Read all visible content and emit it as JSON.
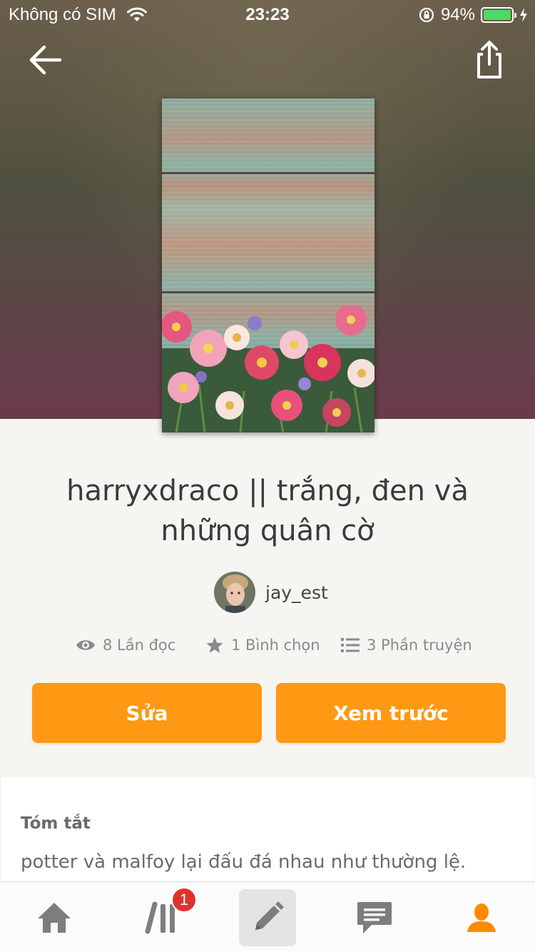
{
  "status_bar": {
    "carrier": "Không có SIM",
    "time": "23:23",
    "battery": "94%",
    "battery_level": 0.94
  },
  "header": {
    "back_icon": "arrow-left-icon",
    "share_icon": "share-icon"
  },
  "story": {
    "title": "harryxdraco || trắng, đen và những quân cờ",
    "author": "jay_est",
    "stats": {
      "reads": "8 Lần đọc",
      "votes": "1 Bình chọn",
      "parts": "3 Phần truyện"
    },
    "edit_label": "Sửa",
    "preview_label": "Xem trước",
    "summary_heading": "Tóm tắt",
    "summary_text": "potter và malfoy lại đấu đá nhau như thường lệ."
  },
  "tabbar": {
    "items": [
      {
        "icon": "home-icon"
      },
      {
        "icon": "library-icon",
        "badge": "1"
      },
      {
        "icon": "pencil-icon"
      },
      {
        "icon": "chat-icon"
      },
      {
        "icon": "profile-icon"
      }
    ]
  },
  "colors": {
    "accent": "#ff9813",
    "badge": "#e0322d",
    "active_tab": "#ff8a00"
  }
}
